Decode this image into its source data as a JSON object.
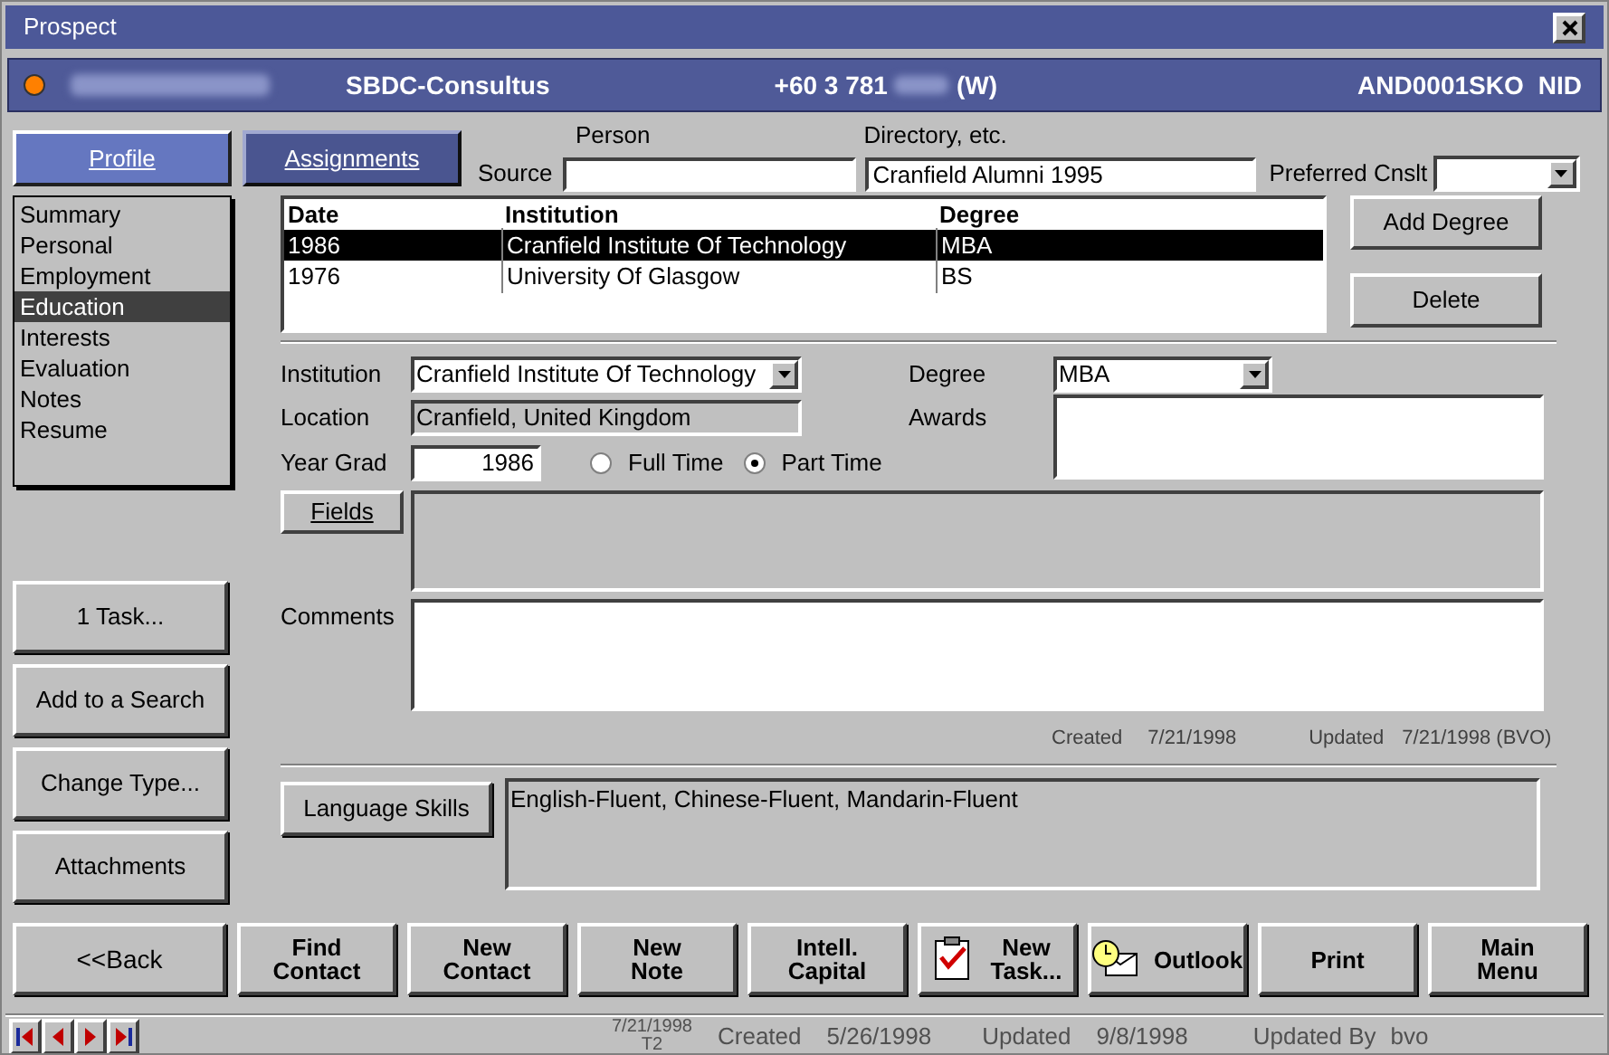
{
  "window": {
    "title": "Prospect"
  },
  "header": {
    "company": "SBDC-Consultus",
    "phone": "+60 3 781",
    "phone_type": "(W)",
    "code": "AND0001SKO",
    "flag": "NID"
  },
  "tabs": [
    {
      "label": "Profile",
      "selected": true
    },
    {
      "label": "Assignments",
      "selected": false
    }
  ],
  "source": {
    "label": "Source",
    "person_label": "Person",
    "directory_label": "Directory, etc.",
    "directory_value": "Cranfield Alumni 1995",
    "preferred_label": "Preferred Cnslt"
  },
  "sections": [
    {
      "label": "Summary",
      "selected": false
    },
    {
      "label": "Personal",
      "selected": false
    },
    {
      "label": "Employment",
      "selected": false
    },
    {
      "label": "Education",
      "selected": true
    },
    {
      "label": "Interests",
      "selected": false
    },
    {
      "label": "Evaluation",
      "selected": false
    },
    {
      "label": "Notes",
      "selected": false
    },
    {
      "label": "Resume",
      "selected": false
    }
  ],
  "side_buttons": [
    "1 Task...",
    "Add to a Search",
    "Change Type...",
    "Attachments"
  ],
  "degrees": {
    "columns": [
      "Date",
      "Institution",
      "Degree"
    ],
    "rows": [
      {
        "cells": [
          "1986",
          "Cranfield Institute Of Technology",
          "MBA"
        ],
        "selected": true
      },
      {
        "cells": [
          "1976",
          "University Of Glasgow",
          "BS"
        ],
        "selected": false
      }
    ]
  },
  "degree_buttons": [
    "Add Degree",
    "Delete"
  ],
  "form": {
    "institution_label": "Institution",
    "institution_value": "Cranfield Institute Of Technology",
    "degree_label": "Degree",
    "degree_value": "MBA",
    "location_label": "Location",
    "location_value": "Cranfield, United Kingdom",
    "awards_label": "Awards",
    "year_label": "Year Grad",
    "year_value": "1986",
    "attendance": [
      {
        "label": "Full Time",
        "selected": false
      },
      {
        "label": "Part Time",
        "selected": true
      }
    ],
    "fields_button": "Fields",
    "comments_label": "Comments",
    "created_label": "Created",
    "created_value": "7/21/1998",
    "updated_label": "Updated",
    "updated_value": "7/21/1998 (BVO)"
  },
  "language": {
    "button": "Language Skills",
    "value": "English-Fluent, Chinese-Fluent, Mandarin-Fluent"
  },
  "toolbar": [
    {
      "kind": "plain",
      "lines": [
        "<<Back"
      ]
    },
    {
      "kind": "bold",
      "lines": [
        "Find",
        "Contact"
      ]
    },
    {
      "kind": "bold",
      "lines": [
        "New",
        "Contact"
      ]
    },
    {
      "kind": "bold",
      "lines": [
        "New",
        "Note"
      ]
    },
    {
      "kind": "bold",
      "lines": [
        "Intell.",
        "Capital"
      ]
    },
    {
      "kind": "task",
      "lines": [
        "New",
        "Task..."
      ]
    },
    {
      "kind": "outlook",
      "lines": [
        "Outlook"
      ]
    },
    {
      "kind": "bold",
      "lines": [
        "Print"
      ]
    },
    {
      "kind": "bold",
      "lines": [
        "Main",
        "Menu"
      ]
    }
  ],
  "status": {
    "date": "7/21/1998",
    "terminal": "T2",
    "created_label": "Created",
    "created_value": "5/26/1998",
    "updated_label": "Updated",
    "updated_value": "9/8/1998",
    "updated_by_label": "Updated By",
    "updated_by_value": "bvo"
  }
}
